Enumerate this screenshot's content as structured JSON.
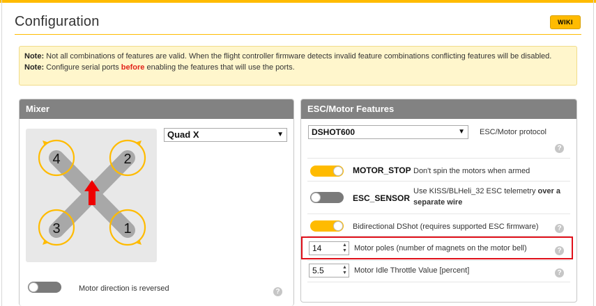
{
  "page": {
    "title": "Configuration",
    "wiki_label": "WIKI"
  },
  "note": {
    "line1_prefix": "Note:",
    "line1_text": " Not all combinations of features are valid. When the flight controller firmware detects invalid feature combinations conflicting features will be disabled.",
    "line2_prefix": "Note:",
    "line2_text_a": " Configure serial ports ",
    "line2_emphasis": "before",
    "line2_text_b": " enabling the features that will use the ports."
  },
  "mixer": {
    "header": "Mixer",
    "selected": "Quad X",
    "motor_labels": [
      "4",
      "2",
      "3",
      "1"
    ],
    "reversed_toggle": false,
    "reversed_label": "Motor direction is reversed"
  },
  "esc": {
    "header": "ESC/Motor Features",
    "protocol_selected": "DSHOT600",
    "protocol_label": "ESC/Motor protocol",
    "motor_stop": {
      "on": true,
      "name": "MOTOR_STOP",
      "desc": "Don't spin the motors when armed"
    },
    "esc_sensor": {
      "on": false,
      "name": "ESC_SENSOR",
      "desc_a": "Use KISS/BLHeli_32 ESC telemetry ",
      "desc_bold": "over a separate wire"
    },
    "bidir": {
      "on": true,
      "desc": "Bidirectional DShot (requires supported ESC firmware)"
    },
    "motor_poles": {
      "value": "14",
      "desc": "Motor poles (number of magnets on the motor bell)"
    },
    "idle_throttle": {
      "value": "5.5",
      "desc": "Motor Idle Throttle Value [percent]"
    }
  },
  "icons": {
    "help": "?",
    "dropdown": "▼",
    "spin_up": "▲",
    "spin_down": "▼"
  },
  "colors": {
    "accent": "#ffbb00",
    "panel_header": "#828282",
    "highlight": "#e0101a",
    "arrow": "#ee0000"
  }
}
